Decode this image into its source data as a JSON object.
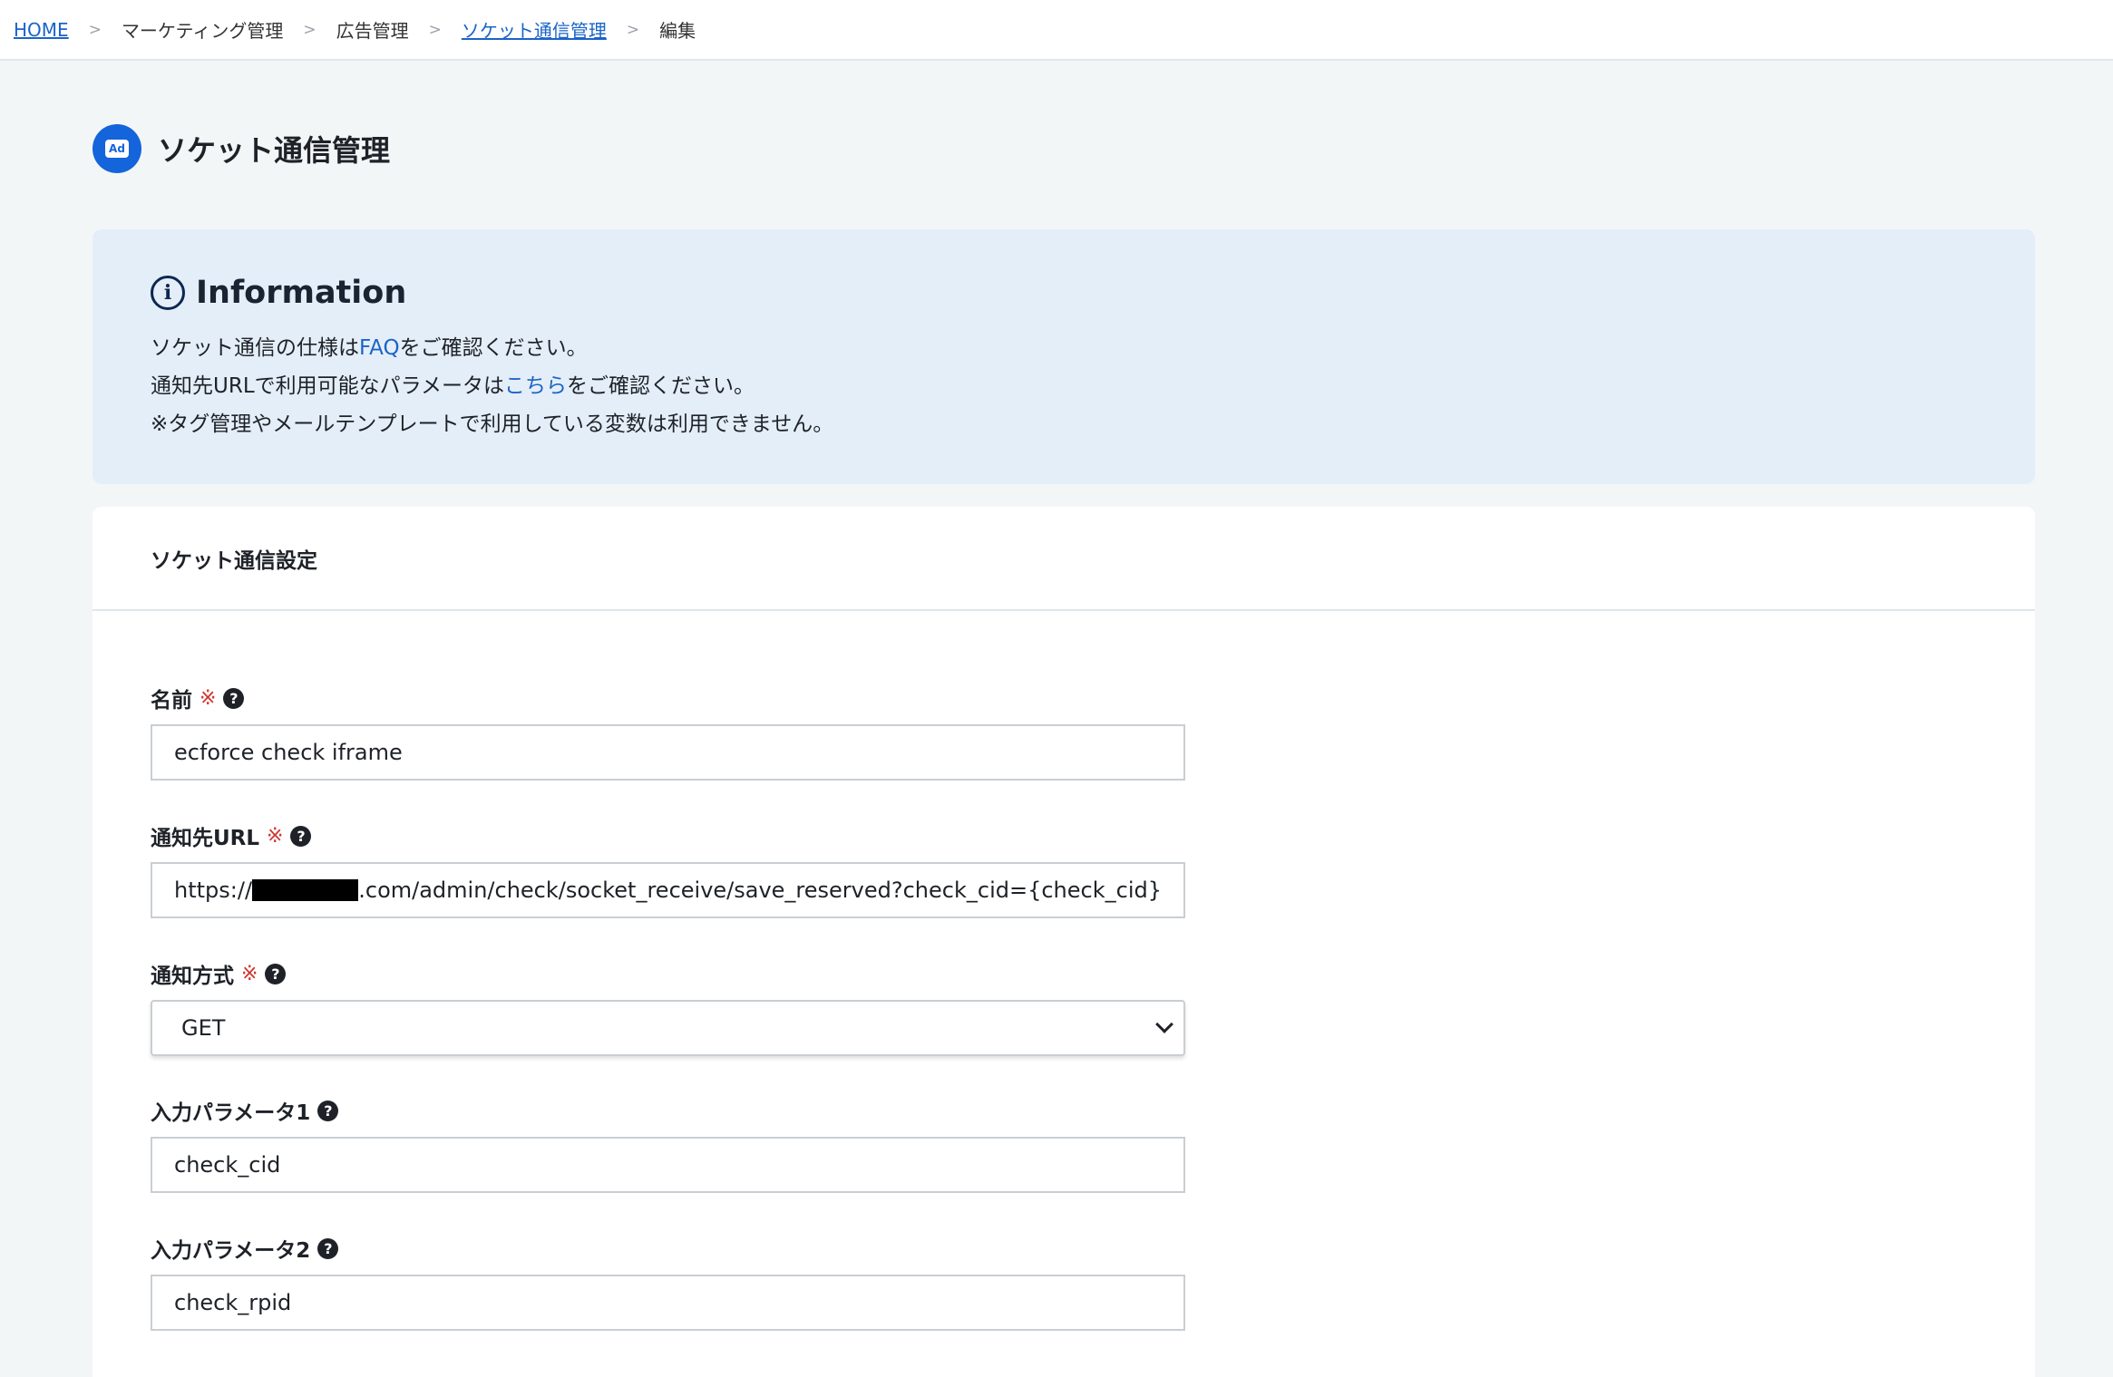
{
  "breadcrumb": {
    "items": [
      {
        "label": "HOME",
        "link": true
      },
      {
        "label": "マーケティング管理",
        "link": false
      },
      {
        "label": "広告管理",
        "link": false
      },
      {
        "label": "ソケット通信管理",
        "link": true
      },
      {
        "label": "編集",
        "link": false
      }
    ],
    "separator": ">"
  },
  "page": {
    "title": "ソケット通信管理",
    "icon_badge": "Ad"
  },
  "info": {
    "title": "Information",
    "icon": "i",
    "line1_pre": "ソケット通信の仕様は",
    "line1_link": "FAQ",
    "line1_post": "をご確認ください。",
    "line2_pre": "通知先URLで利用可能なパラメータは",
    "line2_link": "こちら",
    "line2_post": "をご確認ください。",
    "line3": "※タグ管理やメールテンプレートで利用している変数は利用できません。"
  },
  "card": {
    "title": "ソケット通信設定"
  },
  "form": {
    "required_mark": "※",
    "help_glyph": "?",
    "name": {
      "label": "名前",
      "value": "ecforce check iframe"
    },
    "url": {
      "label": "通知先URL",
      "prefix": "https://",
      "suffix": ".com/admin/check/socket_receive/save_reserved?check_cid={check_cid}"
    },
    "method": {
      "label": "通知方式",
      "selected": "GET"
    },
    "param1": {
      "label": "入力パラメータ1",
      "value": "check_cid"
    },
    "param2": {
      "label": "入力パラメータ2",
      "value": "check_rpid"
    }
  }
}
